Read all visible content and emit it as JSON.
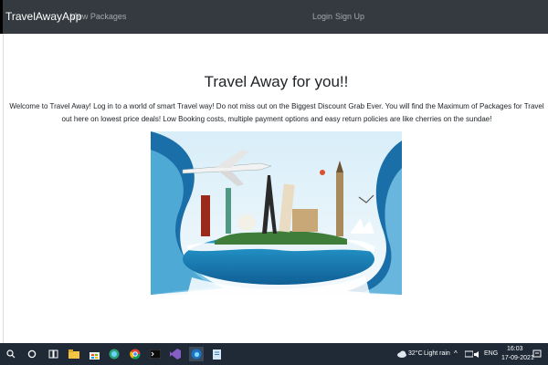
{
  "navbar": {
    "brand": "TravelAwayApp",
    "view_packages": "View Packages",
    "login": "Login",
    "signup": "Sign Up"
  },
  "main": {
    "title": "Travel Away for you!!",
    "welcome": "Welcome to Travel Away! Log in to a world of smart Travel way! Do not miss out on the Biggest Discount Grab Ever. You will find the Maximum of Packages for Travel out here on lowest price deals! Low Booking costs, multiple payment options and easy return policies are like cherries on the sundae!"
  },
  "taskbar": {
    "weather_temp": "32°C",
    "weather_text": "Light rain",
    "language": "ENG",
    "time": "16:03",
    "date": "17-09-2021",
    "icons": [
      "search-icon",
      "cortana-icon",
      "task-view-icon",
      "file-explorer-icon",
      "store-icon",
      "edge-icon",
      "chrome-icon",
      "terminal-icon",
      "visual-studio-icon",
      "edge-dev-icon",
      "notepad-icon"
    ]
  },
  "colors": {
    "navbar_bg": "#343a40",
    "taskbar_bg": "#1f2a36",
    "text": "#212529"
  }
}
